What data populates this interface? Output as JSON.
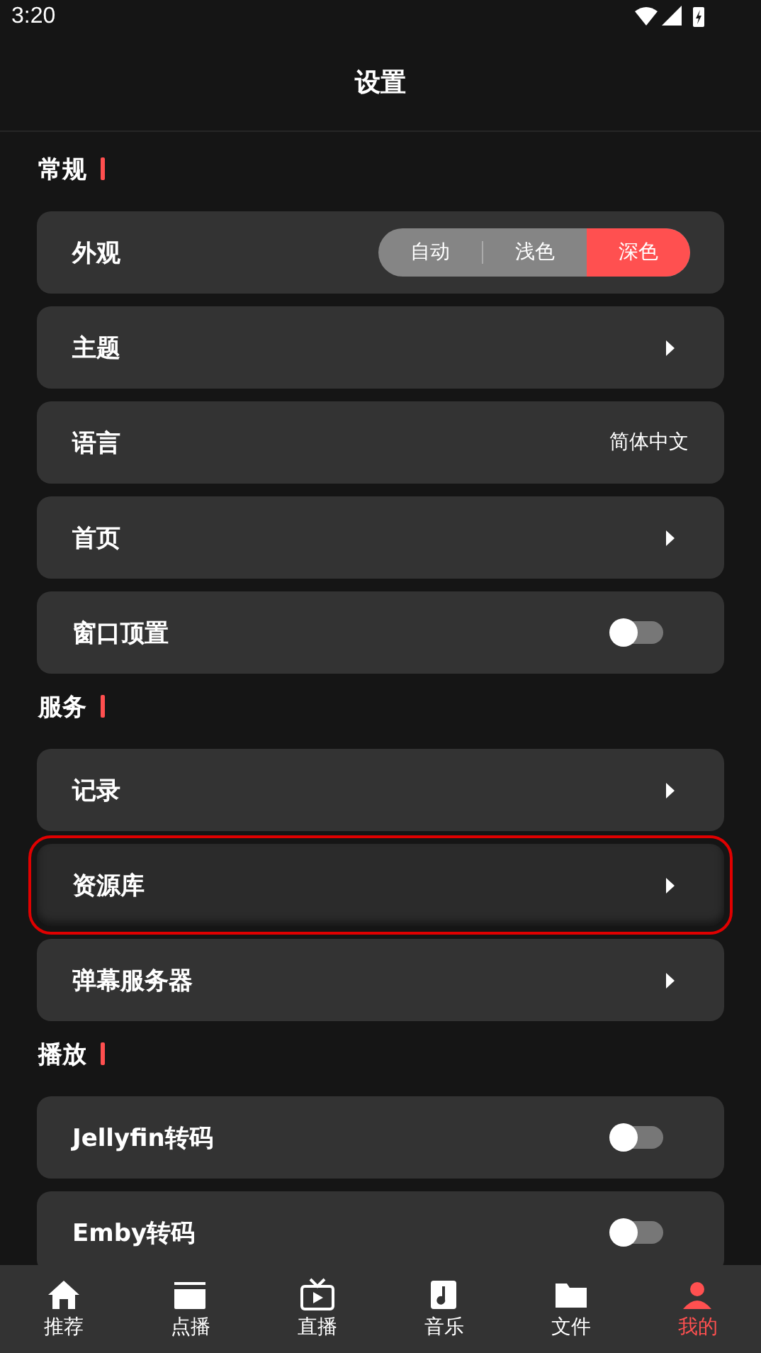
{
  "status_bar": {
    "time": "3:20"
  },
  "header": {
    "title": "设置"
  },
  "sections": [
    {
      "title": "常规",
      "items": [
        {
          "kind": "segmented",
          "label": "外观",
          "highlighted": false,
          "options": [
            {
              "label": "自动",
              "selected": false
            },
            {
              "label": "浅色",
              "selected": false
            },
            {
              "label": "深色",
              "selected": true
            }
          ]
        },
        {
          "kind": "arrow",
          "label": "主题",
          "highlighted": false
        },
        {
          "kind": "value",
          "label": "语言",
          "value": "简体中文",
          "highlighted": false
        },
        {
          "kind": "arrow",
          "label": "首页",
          "highlighted": false
        },
        {
          "kind": "switch",
          "label": "窗口顶置",
          "on": false,
          "highlighted": false
        }
      ]
    },
    {
      "title": "服务",
      "items": [
        {
          "kind": "arrow",
          "label": "记录",
          "highlighted": false
        },
        {
          "kind": "arrow",
          "label": "资源库",
          "highlighted": true
        },
        {
          "kind": "arrow",
          "label": "弹幕服务器",
          "highlighted": false
        }
      ]
    },
    {
      "title": "播放",
      "items": [
        {
          "kind": "switch",
          "label": "Jellyfin转码",
          "on": false,
          "highlighted": false
        },
        {
          "kind": "switch",
          "label": "Emby转码",
          "on": false,
          "highlighted": false
        }
      ]
    }
  ],
  "bottom_nav": [
    {
      "kind": "home",
      "label": "推荐",
      "selected": false
    },
    {
      "kind": "clapper",
      "label": "点播",
      "selected": false
    },
    {
      "kind": "tv",
      "label": "直播",
      "selected": false
    },
    {
      "kind": "music",
      "label": "音乐",
      "selected": false
    },
    {
      "kind": "folder",
      "label": "文件",
      "selected": false
    },
    {
      "kind": "person",
      "label": "我的",
      "selected": true
    }
  ]
}
